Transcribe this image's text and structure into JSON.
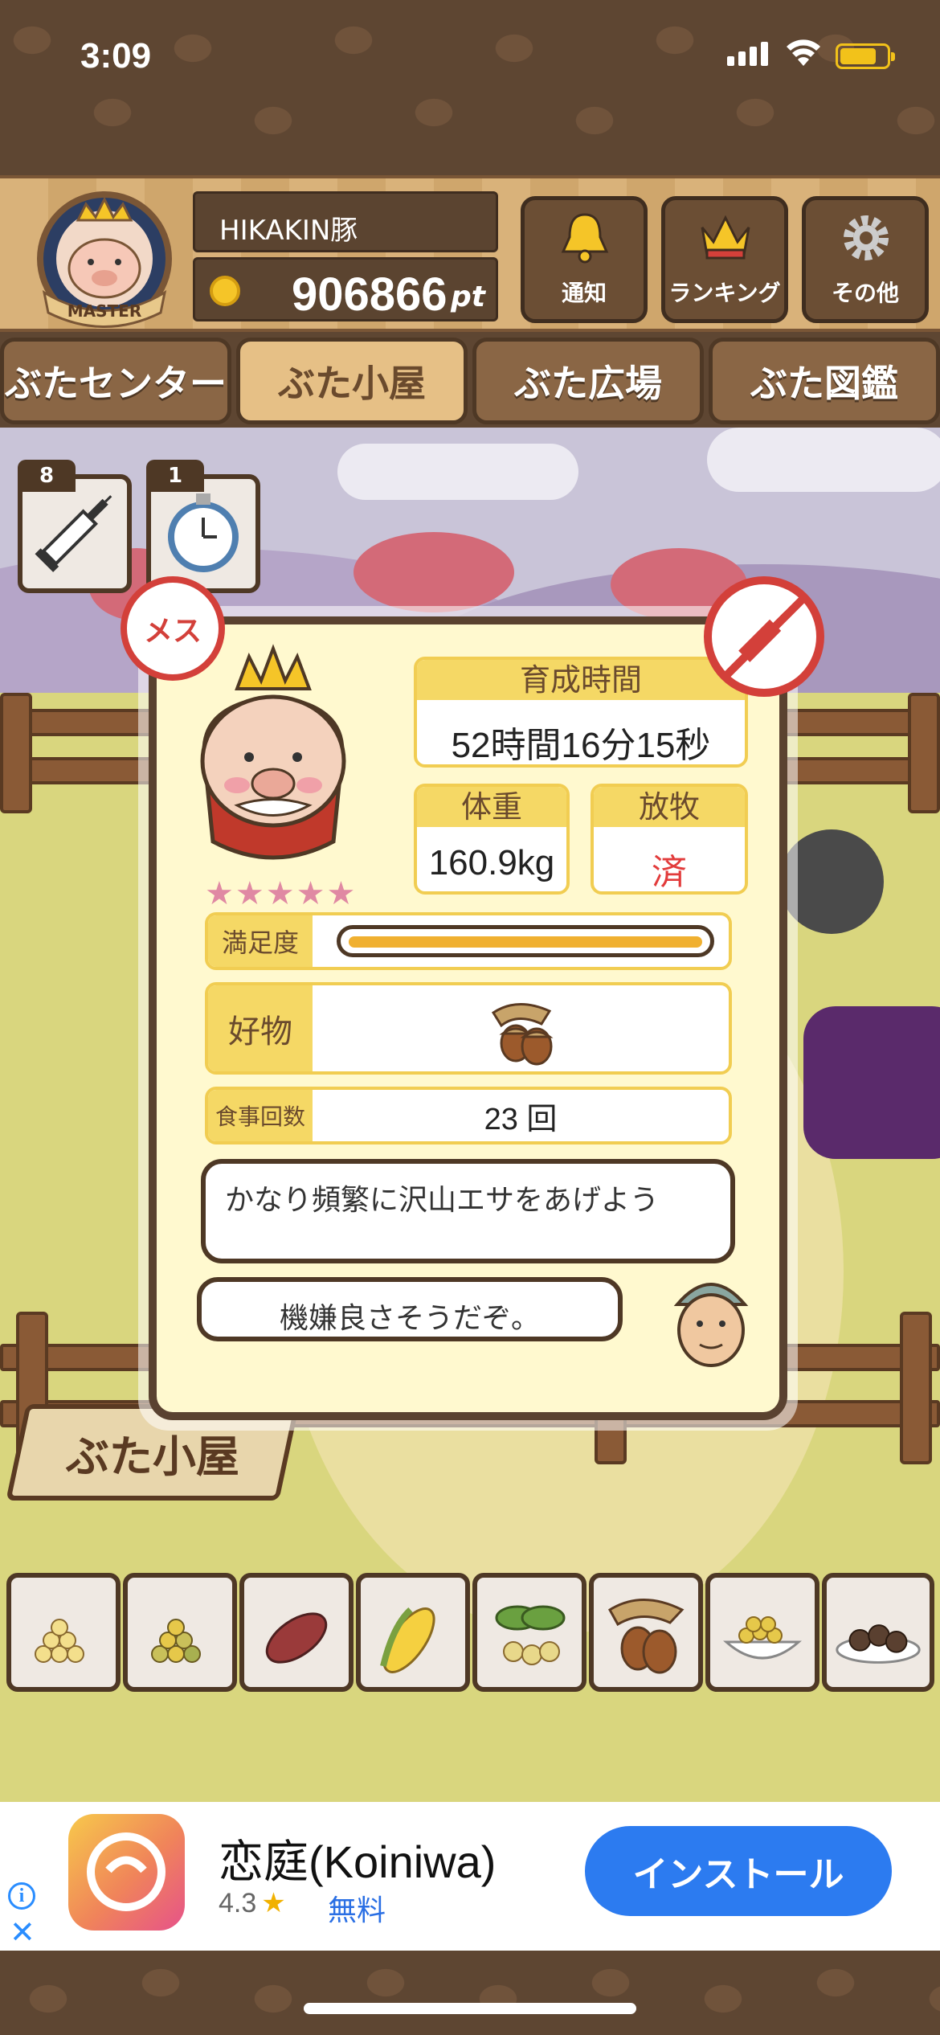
{
  "status_bar": {
    "time": "3:09"
  },
  "header": {
    "badge_label": "MASTER",
    "player_name": "HIKAKIN豚",
    "points_value": "906866",
    "points_unit": "pt",
    "buttons": [
      {
        "label": "通知",
        "icon": "bell-icon"
      },
      {
        "label": "ランキング",
        "icon": "crown-icon"
      },
      {
        "label": "その他",
        "icon": "gear-icon"
      }
    ]
  },
  "tabs": [
    {
      "label": "ぶたセンター",
      "active": false
    },
    {
      "label": "ぶた小屋",
      "active": true
    },
    {
      "label": "ぶた広場",
      "active": false
    },
    {
      "label": "ぶた図鑑",
      "active": false
    }
  ],
  "items": [
    {
      "count": "8",
      "icon": "syringe-icon"
    },
    {
      "count": "1",
      "icon": "stopwatch-icon"
    }
  ],
  "pig_card": {
    "gender_label": "メス",
    "stars": "★★★★★",
    "star_count": 5,
    "growth_time_label": "育成時間",
    "growth_time_value": "52時間16分15秒",
    "weight_label": "体重",
    "weight_value": "160.9kg",
    "pasture_label": "放牧",
    "pasture_value": "済",
    "satisfaction_label": "満足度",
    "satisfaction_level": 1.0,
    "favorite_label": "好物",
    "favorite_icon": "acorn-icon",
    "meals_label": "食事回数",
    "meals_value": "23 回",
    "advice_text": "かなり頻繁に沢山エサをあげよう",
    "mood_text": "機嫌良さそうだぞ。"
  },
  "sign_label": "ぶた小屋",
  "food_slots": [
    "grain-pile-icon",
    "mixed-grain-icon",
    "sweet-potato-icon",
    "corn-icon",
    "nuts-leaf-icon",
    "acorn-icon",
    "bean-bowl-icon",
    "truffle-plate-icon"
  ],
  "ad": {
    "app_name": "恋庭(Koiniwa)",
    "rating": "4.3",
    "price": "無料",
    "install_label": "インストール"
  },
  "colors": {
    "accent_yellow": "#f5d865",
    "wood_dark": "#4e3825",
    "alert_red": "#d3403a",
    "install_blue": "#2c7bf0"
  }
}
